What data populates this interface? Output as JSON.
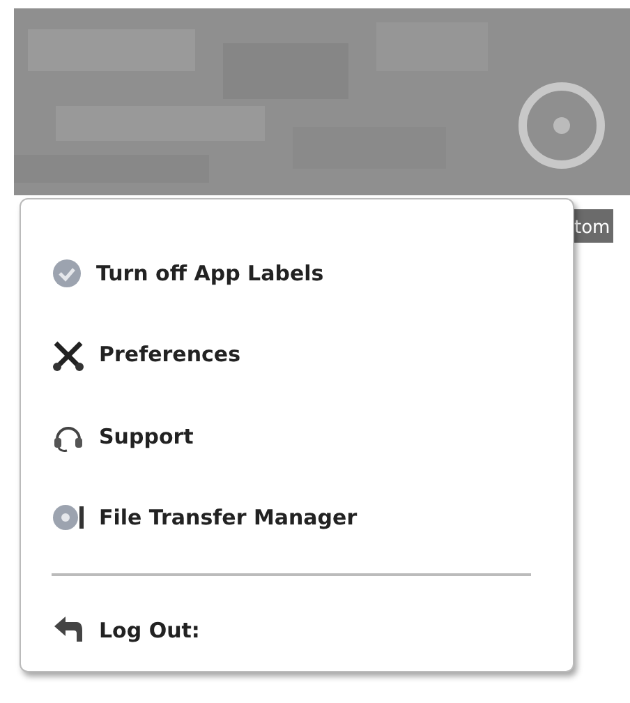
{
  "header": {
    "kind": "picture",
    "settings_label": "tom"
  },
  "menu": {
    "items": [
      {
        "kind": "item",
        "label": "Turn off App Labels"
      },
      {
        "kind": "item",
        "label": "Preferences"
      },
      {
        "kind": "item",
        "label": "Support"
      },
      {
        "kind": "item",
        "label": "File Transfer Manager"
      },
      {
        "kind": "separator"
      },
      {
        "kind": "item",
        "label": "Log Out:"
      }
    ]
  }
}
